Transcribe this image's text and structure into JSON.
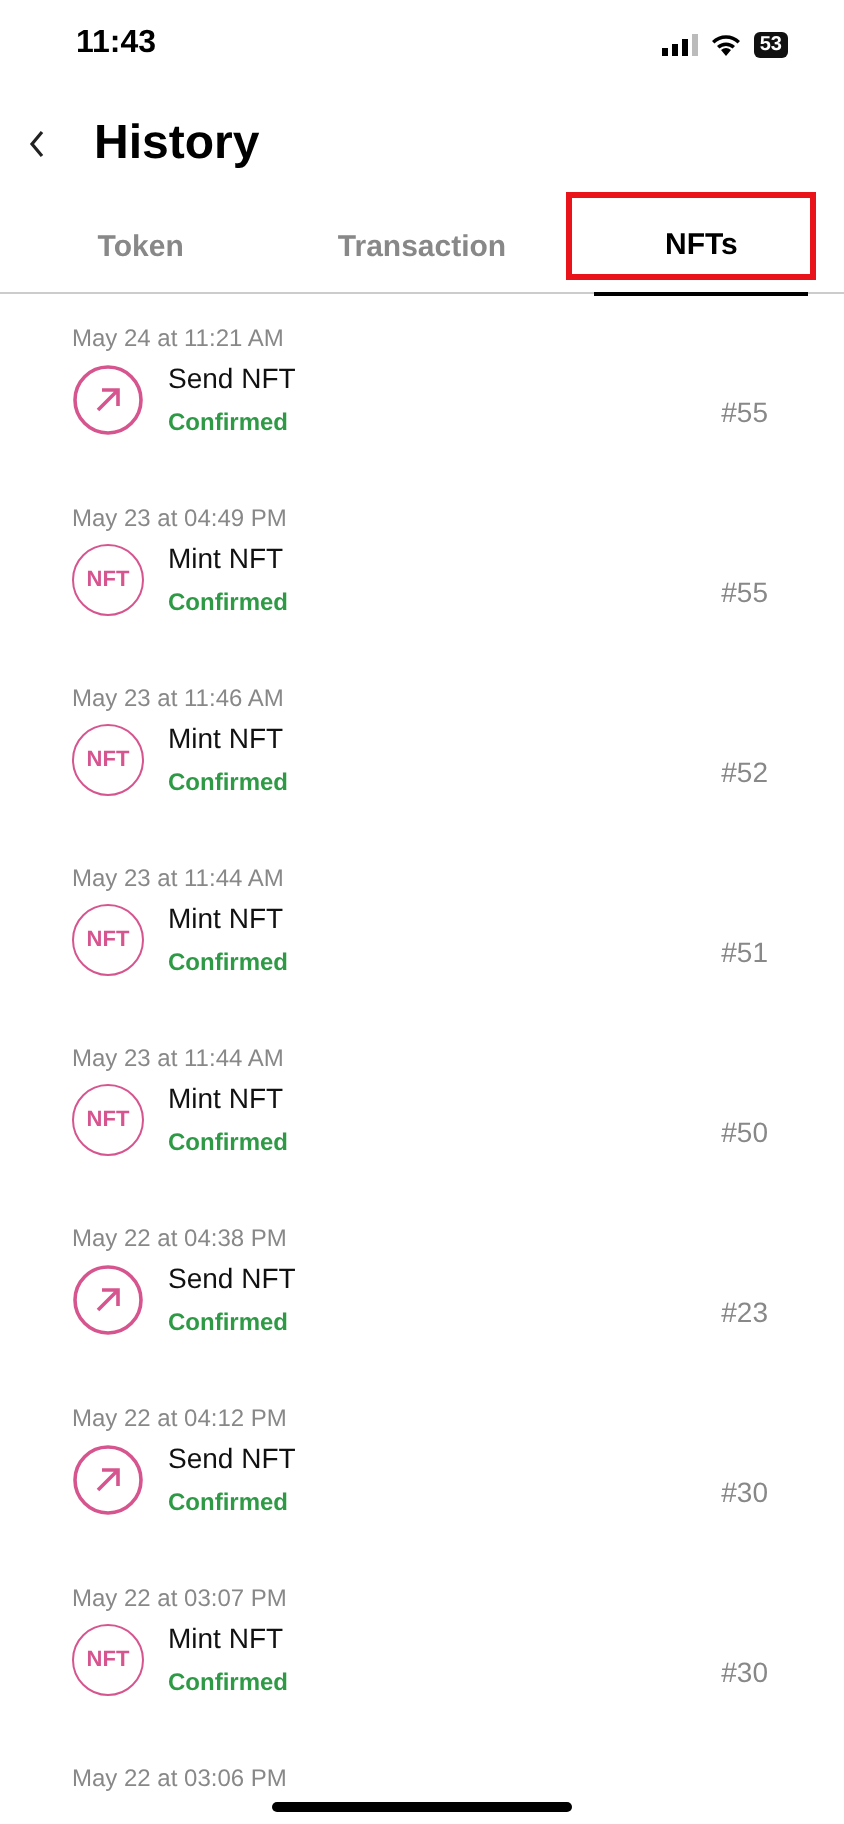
{
  "status_bar": {
    "time": "11:43",
    "battery": "53"
  },
  "header": {
    "title": "History"
  },
  "tabs": [
    {
      "label": "Token",
      "selected": false,
      "highlighted": false
    },
    {
      "label": "Transaction",
      "selected": false,
      "highlighted": false
    },
    {
      "label": "NFTs",
      "selected": true,
      "highlighted": true
    }
  ],
  "items": [
    {
      "date": "May 24 at 11:21 AM",
      "kind": "send",
      "title": "Send NFT",
      "status": "Confirmed",
      "token": "#55"
    },
    {
      "date": "May 23 at 04:49 PM",
      "kind": "mint",
      "icon_text": "NFT",
      "title": "Mint NFT",
      "status": "Confirmed",
      "token": "#55"
    },
    {
      "date": "May 23 at 11:46 AM",
      "kind": "mint",
      "icon_text": "NFT",
      "title": "Mint NFT",
      "status": "Confirmed",
      "token": "#52"
    },
    {
      "date": "May 23 at 11:44 AM",
      "kind": "mint",
      "icon_text": "NFT",
      "title": "Mint NFT",
      "status": "Confirmed",
      "token": "#51"
    },
    {
      "date": "May 23 at 11:44 AM",
      "kind": "mint",
      "icon_text": "NFT",
      "title": "Mint NFT",
      "status": "Confirmed",
      "token": "#50"
    },
    {
      "date": "May 22 at 04:38 PM",
      "kind": "send",
      "title": "Send NFT",
      "status": "Confirmed",
      "token": "#23"
    },
    {
      "date": "May 22 at 04:12 PM",
      "kind": "send",
      "title": "Send NFT",
      "status": "Confirmed",
      "token": "#30"
    },
    {
      "date": "May 22 at 03:07 PM",
      "kind": "mint",
      "icon_text": "NFT",
      "title": "Mint NFT",
      "status": "Confirmed",
      "token": "#30"
    },
    {
      "date": "May 22 at 03:06 PM"
    }
  ]
}
